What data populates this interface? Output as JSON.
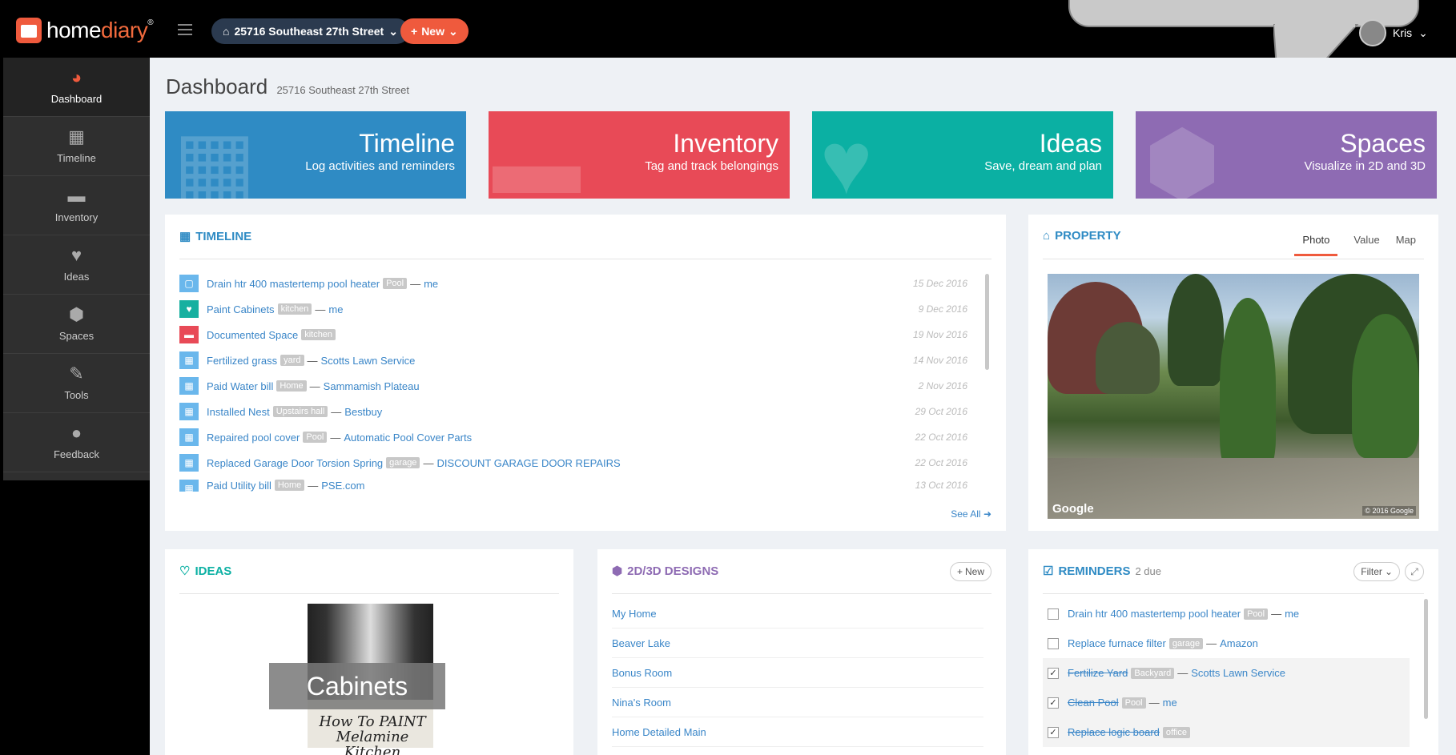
{
  "topbar": {
    "logo_home": "home",
    "logo_diary": "diary",
    "logo_reg": "®",
    "address_label": "25716 Southeast 27th Street",
    "new_label": "New",
    "user_name": "Kris"
  },
  "sidebar": {
    "items": [
      {
        "label": "Dashboard",
        "icon": "dashboard-icon"
      },
      {
        "label": "Timeline",
        "icon": "calendar-icon"
      },
      {
        "label": "Inventory",
        "icon": "box-icon"
      },
      {
        "label": "Ideas",
        "icon": "heart-icon"
      },
      {
        "label": "Spaces",
        "icon": "cube-icon"
      },
      {
        "label": "Tools",
        "icon": "wrench-icon"
      },
      {
        "label": "Feedback",
        "icon": "comment-icon"
      }
    ]
  },
  "page": {
    "title": "Dashboard",
    "subtitle": "25716 Southeast 27th Street"
  },
  "tiles": [
    {
      "title": "Timeline",
      "subtitle": "Log activities and reminders",
      "color": "#2f8bc4"
    },
    {
      "title": "Inventory",
      "subtitle": "Tag and track belongings",
      "color": "#e84a57"
    },
    {
      "title": "Ideas",
      "subtitle": "Save, dream and plan",
      "color": "#0bb0a3"
    },
    {
      "title": "Spaces",
      "subtitle": "Visualize in 2D and 3D",
      "color": "#8e6bb3"
    }
  ],
  "timeline": {
    "heading": "TIMELINE",
    "see_all": "See All",
    "rows": [
      {
        "text": "Drain htr 400 mastertemp pool heater",
        "tag": "Pool",
        "sep": "—",
        "who": "me",
        "date": "15 Dec 2016",
        "icon_color": "#6ab7ec",
        "icon": "checkbox-icon"
      },
      {
        "text": "Paint Cabinets",
        "tag": "kitchen",
        "sep": "—",
        "who": "me",
        "date": "9 Dec 2016",
        "icon_color": "#17b0a0",
        "icon": "heart-icon"
      },
      {
        "text": "Documented Space",
        "tag": "kitchen",
        "sep": "",
        "who": "",
        "date": "19 Nov 2016",
        "icon_color": "#e84a57",
        "icon": "box-icon"
      },
      {
        "text": "Fertilized grass",
        "tag": "yard",
        "sep": "—",
        "who": "Scotts Lawn Service",
        "date": "14 Nov 2016",
        "icon_color": "#6ab7ec",
        "icon": "calendar-icon"
      },
      {
        "text": "Paid Water bill",
        "tag": "Home",
        "sep": "—",
        "who": "Sammamish Plateau",
        "date": "2 Nov 2016",
        "icon_color": "#6ab7ec",
        "icon": "calendar-icon"
      },
      {
        "text": "Installed Nest",
        "tag": "Upstairs hall",
        "sep": "—",
        "who": "Bestbuy",
        "date": "29 Oct 2016",
        "icon_color": "#6ab7ec",
        "icon": "calendar-icon"
      },
      {
        "text": "Repaired pool cover",
        "tag": "Pool",
        "sep": "—",
        "who": "Automatic Pool Cover Parts",
        "date": "22 Oct 2016",
        "icon_color": "#6ab7ec",
        "icon": "calendar-icon"
      },
      {
        "text": "Replaced Garage Door Torsion Spring",
        "tag": "garage",
        "sep": "—",
        "who": "DISCOUNT GARAGE DOOR REPAIRS",
        "date": "22 Oct 2016",
        "icon_color": "#6ab7ec",
        "icon": "calendar-icon"
      },
      {
        "text": "Paid Utility bill",
        "tag": "Home",
        "sep": "—",
        "who": "PSE.com",
        "date": "13 Oct 2016",
        "icon_color": "#6ab7ec",
        "icon": "calendar-icon"
      }
    ]
  },
  "property": {
    "heading": "PROPERTY",
    "tabs": [
      "Photo",
      "Value",
      "Map"
    ],
    "active_tab": "Photo",
    "photo_brand": "Google",
    "photo_copyright": "© 2016 Google"
  },
  "ideas": {
    "heading": "IDEAS",
    "card_label": "Cabinets",
    "card_script": "How To PAINT Melamine Kitchen"
  },
  "designs": {
    "heading": "2D/3D DESIGNS",
    "new_label": "New",
    "items": [
      "My Home",
      "Beaver Lake",
      "Bonus Room",
      "Nina's Room",
      "Home Detailed Main"
    ]
  },
  "reminders": {
    "heading": "REMINDERS",
    "due": "2 due",
    "filter_label": "Filter",
    "rows": [
      {
        "text": "Drain htr 400 mastertemp pool heater",
        "tag": "Pool",
        "sep": "—",
        "who": "me",
        "done": false
      },
      {
        "text": "Replace furnace filter",
        "tag": "garage",
        "sep": "—",
        "who": "Amazon",
        "done": false
      },
      {
        "text": "Fertilize Yard",
        "tag": "Backyard",
        "sep": "—",
        "who": "Scotts Lawn Service",
        "done": true
      },
      {
        "text": "Clean Pool",
        "tag": "Pool",
        "sep": "—",
        "who": "me",
        "done": true
      },
      {
        "text": "Replace logic board",
        "tag": "office",
        "sep": "",
        "who": "",
        "done": true
      }
    ]
  },
  "colors": {
    "accent": "#ef5a3d",
    "link": "#3a86c8",
    "timeline_blue": "#2f8bc4",
    "ideas_teal": "#0bb0a3",
    "designs_purple": "#8e6bb3"
  }
}
